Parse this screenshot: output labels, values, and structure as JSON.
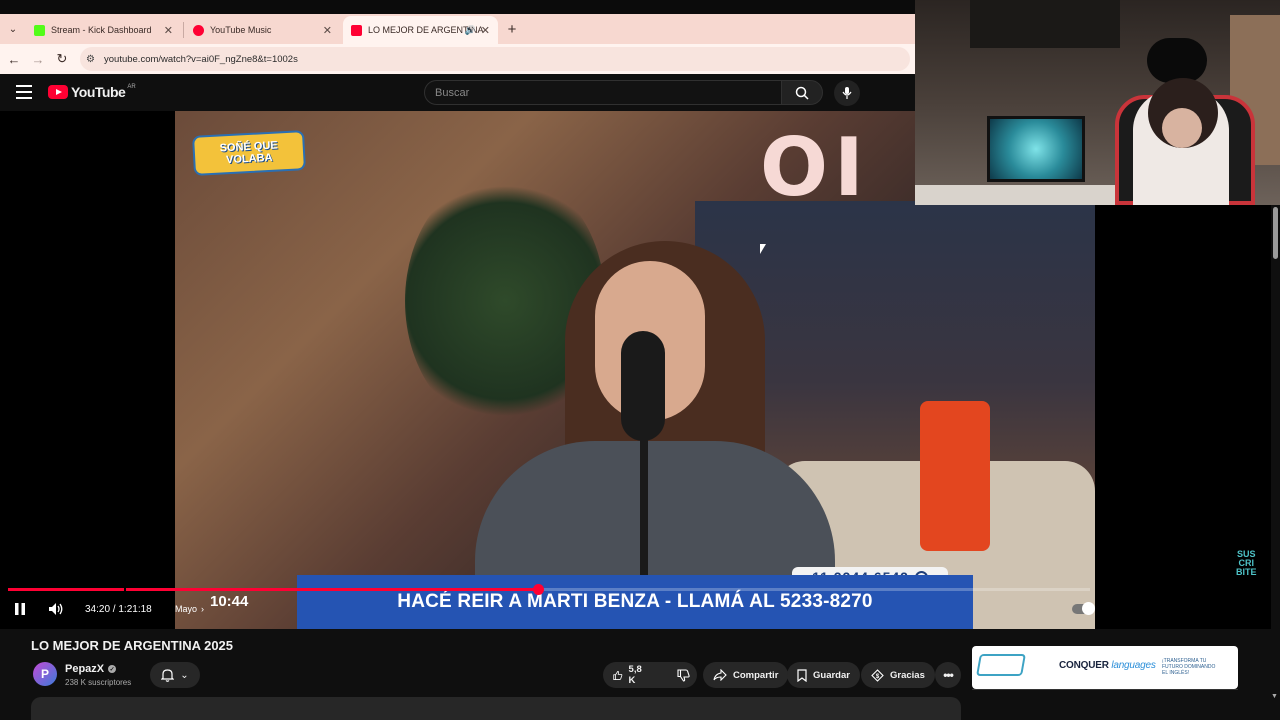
{
  "browser": {
    "tabs": [
      {
        "label": "Stream - Kick Dashboard",
        "favicon_color": "#53fc18"
      },
      {
        "label": "YouTube Music",
        "favicon_color": "#ff0033"
      },
      {
        "label": "LO MEJOR DE ARGENTINA",
        "favicon_color": "#ff0033",
        "active": true
      }
    ],
    "url": "youtube.com/watch?v=ai0F_ngZne8&t=1002s"
  },
  "youtube": {
    "logo_text": "YouTube",
    "country_code": "AR",
    "search_placeholder": "Buscar"
  },
  "player": {
    "current_time": "34:20",
    "duration": "1:21:18",
    "time_display": "34:20 / 1:21:18",
    "chapter": "Mayo",
    "progress_fraction": 0.49,
    "overlay_clock": "10:44",
    "video_logo_lines": [
      "SOÑÉ QUE",
      "VOLABA"
    ],
    "video_sign": "OI",
    "phone_tag": "11 2244 6542",
    "lower_third": "HACÉ REIR A MARTI BENZA - LLAMÁ AL 5233-8270",
    "subscribe_tag": [
      "SUS",
      "CRI",
      "BITE"
    ]
  },
  "video": {
    "title": "LO MEJOR DE ARGENTINA 2025",
    "channel": {
      "name": "PepazX",
      "subscribers": "238 K suscriptores"
    },
    "actions": {
      "likes": "5,8 K",
      "share": "Compartir",
      "save": "Guardar",
      "thanks": "Gracias"
    }
  },
  "ad": {
    "brand_main": "CONQUER",
    "brand_script": "languages",
    "tagline": "¡TRANSFORMA TU FUTURO DOMINANDO EL INGLÉS!"
  },
  "colors": {
    "accent": "#ff0033",
    "lower_third_bg": "#2554b3",
    "tabstrip_bg": "#f7d8d0"
  }
}
